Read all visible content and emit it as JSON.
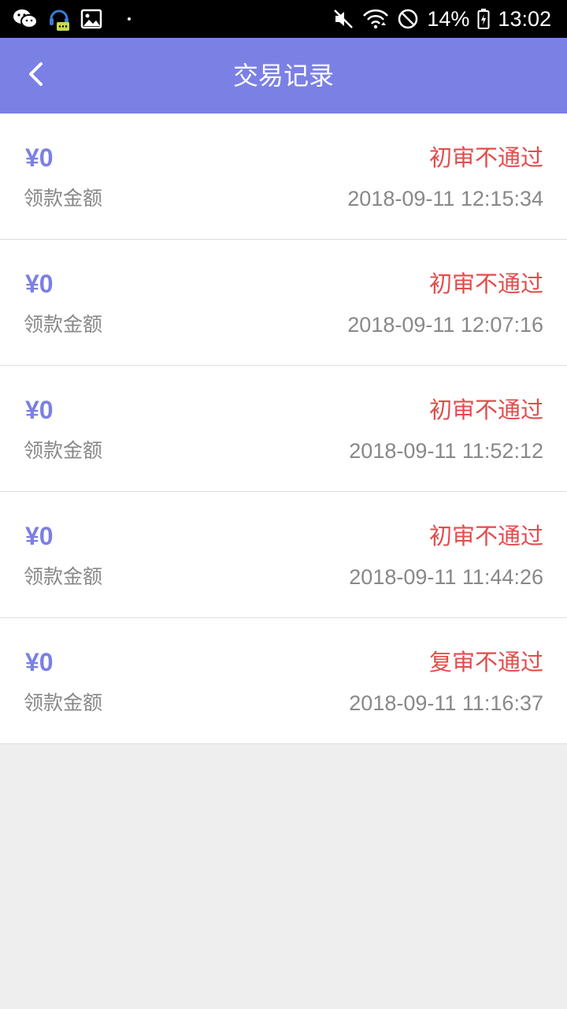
{
  "status_bar": {
    "battery": "14%",
    "time": "13:02",
    "icons": [
      "wechat-icon",
      "headset-chat-icon",
      "gallery-icon",
      "mute-icon",
      "wifi-icon",
      "no-signal-icon",
      "battery-charging-icon"
    ]
  },
  "header": {
    "title": "交易记录",
    "background": "#7b80e4"
  },
  "records": [
    {
      "amount": "¥0",
      "label": "领款金额",
      "status": "初审不通过",
      "time": "2018-09-11 12:15:34"
    },
    {
      "amount": "¥0",
      "label": "领款金额",
      "status": "初审不通过",
      "time": "2018-09-11 12:07:16"
    },
    {
      "amount": "¥0",
      "label": "领款金额",
      "status": "初审不通过",
      "time": "2018-09-11 11:52:12"
    },
    {
      "amount": "¥0",
      "label": "领款金额",
      "status": "初审不通过",
      "time": "2018-09-11 11:44:26"
    },
    {
      "amount": "¥0",
      "label": "领款金额",
      "status": "复审不通过",
      "time": "2018-09-11 11:16:37"
    }
  ],
  "colors": {
    "accent": "#7b80e4",
    "status_red": "#e34c4c",
    "muted_text": "#888888",
    "page_bg": "#eeeeee"
  }
}
